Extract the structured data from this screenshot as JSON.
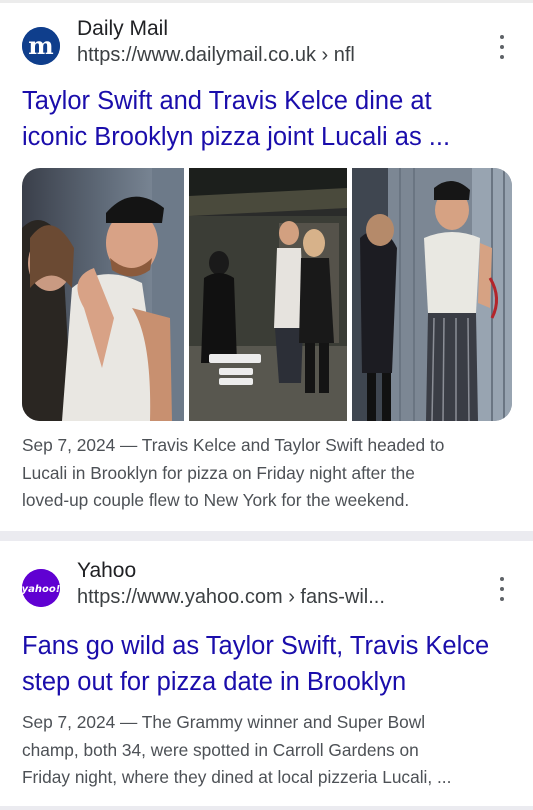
{
  "results": [
    {
      "source_name": "Daily Mail",
      "source_url": "https://www.dailymail.co.uk › nfl",
      "favicon_letter": "m",
      "headline_line1": "Taylor Swift and Travis Kelce dine at",
      "headline_line2": "iconic Brooklyn pizza joint Lucali as ...",
      "snippet_line1": "Sep 7, 2024 — Travis Kelce and Taylor Swift headed to",
      "snippet_line2": "Lucali in Brooklyn for pizza on Friday night after the",
      "snippet_line3": "loved-up couple flew to New York for the weekend."
    },
    {
      "source_name": "Yahoo",
      "source_url": "https://www.yahoo.com › fans-wil...",
      "favicon_text": "yahoo!",
      "headline_line1": "Fans go wild as Taylor Swift, Travis Kelce",
      "headline_line2": "step out for pizza date in Brooklyn",
      "snippet_line1": "Sep 7, 2024 — The Grammy winner and Super Bowl",
      "snippet_line2": "champ, both 34, were spotted in Carroll Gardens on",
      "snippet_line3": "Friday night, where they dined at local pizzeria Lucali, ..."
    }
  ],
  "colors": {
    "link": "#1a0dab",
    "daily_mail_brand": "#0f3e8c",
    "yahoo_brand": "#6001d2",
    "snippet": "#4d5156"
  },
  "icons": [
    "daily-mail-favicon",
    "yahoo-favicon",
    "more-vert-icon"
  ]
}
